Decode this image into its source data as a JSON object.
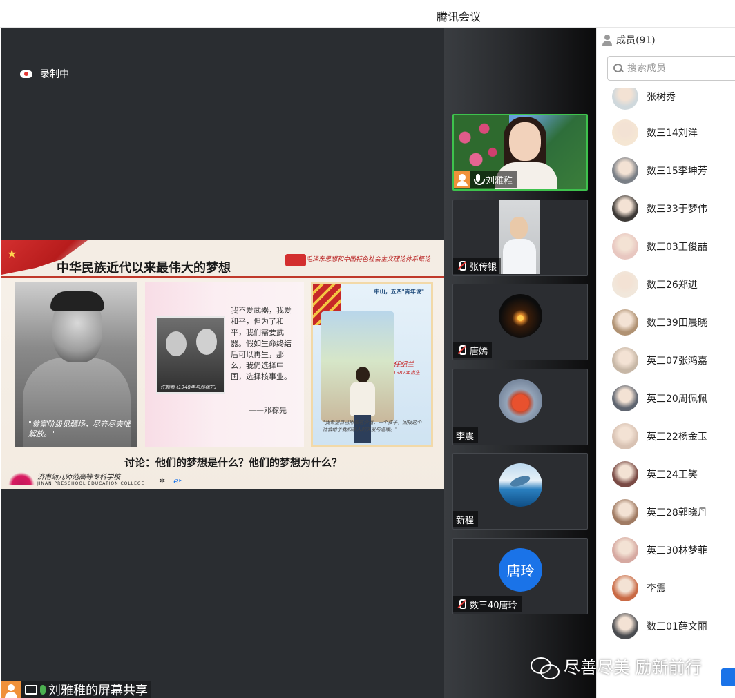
{
  "window": {
    "title": "腾讯会议"
  },
  "recording": {
    "label": "录制中"
  },
  "slide": {
    "title": "中华民族近代以来最伟大的梦想",
    "subtitle": "毛泽东思想和中国特色社会主义理论体系概论",
    "photo1_quote": "\"贫富阶级见疆场，尽齐尽夫唯解放。\"",
    "poem": "我不爱武器，我爱和平，但为了和平，我们需要武器。假如生命终结后可以再生，那么，我仍选择中国，选择核事业。",
    "poem_author": "——邓稼先",
    "couple_caption": "许鹿希 (1948年与邓稼先)",
    "panel3_sign": "中山，五四\"青年说\"",
    "panel3_name": "任纪兰",
    "panel3_sub": "1982年出生",
    "panel3_caption": "\"我希望自己所做有价值，一个孩子，回报这个社会给予我和家人的关爱与温暖。\"",
    "discussion": "讨论：他们的梦想是什么？他们的梦想为什么？",
    "college_cn": "济南幼儿师范高等专科学校",
    "college_en": "JINAN PRESCHOOL EDUCATION COLLEGE"
  },
  "share_footer": {
    "label": "刘雅稚的屏幕共享"
  },
  "videos": [
    {
      "name": "刘雅稚",
      "type": "camera",
      "mic": "on",
      "host": true
    },
    {
      "name": "张传银",
      "type": "camera",
      "mic": "off"
    },
    {
      "name": "唐嫣",
      "type": "avatar",
      "mic": "off",
      "avatar": "candle"
    },
    {
      "name": "李震",
      "type": "avatar",
      "mic": "none",
      "avatar": "fish"
    },
    {
      "name": "新程",
      "type": "avatar",
      "mic": "none",
      "avatar": "dolphin"
    },
    {
      "name": "数三40唐玲",
      "type": "avatar",
      "mic": "off",
      "avatar_text": "唐玲"
    }
  ],
  "members": {
    "header": "成员(91)",
    "search_placeholder": "搜索成员",
    "list": [
      {
        "name": "张树秀",
        "color": "#cfd8dc"
      },
      {
        "name": "数三14刘洋",
        "color": "#f5e6d3"
      },
      {
        "name": "数三15李坤芳",
        "color": "#7a7f86"
      },
      {
        "name": "数三33于梦伟",
        "color": "#3e3a37"
      },
      {
        "name": "数三03王俊喆",
        "color": "#e8c7c0"
      },
      {
        "name": "数三26郑进",
        "color": "#f1e7db"
      },
      {
        "name": "数三39田晨晓",
        "color": "#b09273"
      },
      {
        "name": "英三07张鸿嘉",
        "color": "#c7b7a6"
      },
      {
        "name": "英三20周佩佩",
        "color": "#5f6570"
      },
      {
        "name": "英三22杨金玉",
        "color": "#d8c2b3"
      },
      {
        "name": "英三24王笑",
        "color": "#7a4b45"
      },
      {
        "name": "英三28郭晓丹",
        "color": "#a07b63"
      },
      {
        "name": "英三30林梦菲",
        "color": "#d6a9a1"
      },
      {
        "name": "李震",
        "color": "#c96a45"
      },
      {
        "name": "数三01薛文丽",
        "color": "#4a4c50"
      }
    ]
  },
  "watermark": {
    "text": "尽善尽美 励新前行"
  }
}
